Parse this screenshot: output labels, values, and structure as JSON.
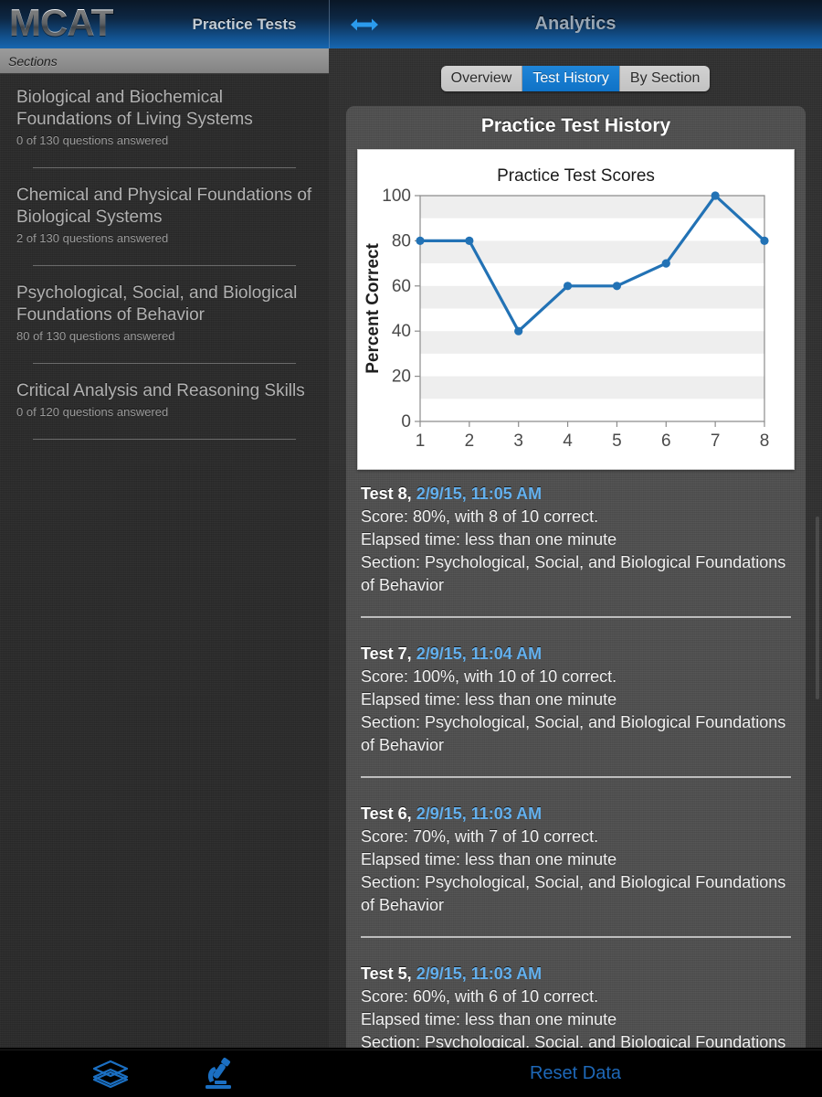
{
  "header": {
    "logo": "MCAT",
    "left_title": "Practice Tests",
    "right_title": "Analytics",
    "resize_icon": "left-right-arrows-icon"
  },
  "sidebar": {
    "bar_label": "Sections",
    "items": [
      {
        "title": "Biological and Biochemical Foundations of Living Systems",
        "progress": "0 of 130 questions answered"
      },
      {
        "title": "Chemical and Physical Foundations of Biological Systems",
        "progress": "2 of 130 questions answered"
      },
      {
        "title": "Psychological, Social, and Biological Foundations of Behavior",
        "progress": "80 of 130 questions answered"
      },
      {
        "title": "Critical Analysis and Reasoning Skills",
        "progress": "0 of 120 questions answered"
      }
    ]
  },
  "segmented_control": {
    "options": [
      "Overview",
      "Test History",
      "By Section"
    ],
    "selected": "Test History",
    "active_color": "#0f72c6",
    "inactive_color": "#c9c9c9"
  },
  "panel": {
    "title": "Practice Test History"
  },
  "chart_data": {
    "type": "line",
    "title": "Practice Test Scores",
    "xlabel": "",
    "ylabel": "Percent Correct",
    "x": [
      1,
      2,
      3,
      4,
      5,
      6,
      7,
      8
    ],
    "xticklabels": [
      "1",
      "2",
      "3",
      "4",
      "5",
      "6",
      "7",
      "8"
    ],
    "values": [
      80,
      80,
      40,
      60,
      60,
      70,
      100,
      80
    ],
    "yticks": [
      0,
      20,
      40,
      60,
      80,
      100
    ],
    "yticklabels": [
      "0",
      "20",
      "40",
      "60",
      "80",
      "100"
    ],
    "ylim": [
      0,
      100
    ],
    "xlim": [
      1,
      8
    ],
    "grid": false,
    "banded_background": true,
    "band_color": "#eeeeee",
    "line_color": "#2272b5",
    "marker": "circle",
    "legend": null
  },
  "test_history": [
    {
      "test": "Test 8,",
      "date": "2/9/15, 11:05 AM",
      "score": "Score: 80%, with 8 of 10 correct.",
      "elapsed": "Elapsed time: less than one minute",
      "section": "Section: Psychological, Social, and Biological Foundations of Behavior"
    },
    {
      "test": "Test 7,",
      "date": "2/9/15, 11:04 AM",
      "score": "Score: 100%, with 10 of 10 correct.",
      "elapsed": "Elapsed time: less than one minute",
      "section": "Section: Psychological, Social, and Biological Foundations of Behavior"
    },
    {
      "test": "Test 6,",
      "date": "2/9/15, 11:03 AM",
      "score": "Score: 70%, with 7 of 10 correct.",
      "elapsed": "Elapsed time: less than one minute",
      "section": "Section: Psychological, Social, and Biological Foundations of Behavior"
    },
    {
      "test": "Test 5,",
      "date": "2/9/15, 11:03 AM",
      "score": "Score: 60%, with 6 of 10 correct.",
      "elapsed": "Elapsed time: less than one minute",
      "section": "Section: Psychological, Social, and Biological Foundations of Behavior"
    }
  ],
  "toolbar": {
    "tabs": [
      {
        "icon": "layers-stack-icon"
      },
      {
        "icon": "microscope-icon"
      }
    ],
    "reset_label": "Reset Data",
    "accent_color": "#1e68b8"
  }
}
